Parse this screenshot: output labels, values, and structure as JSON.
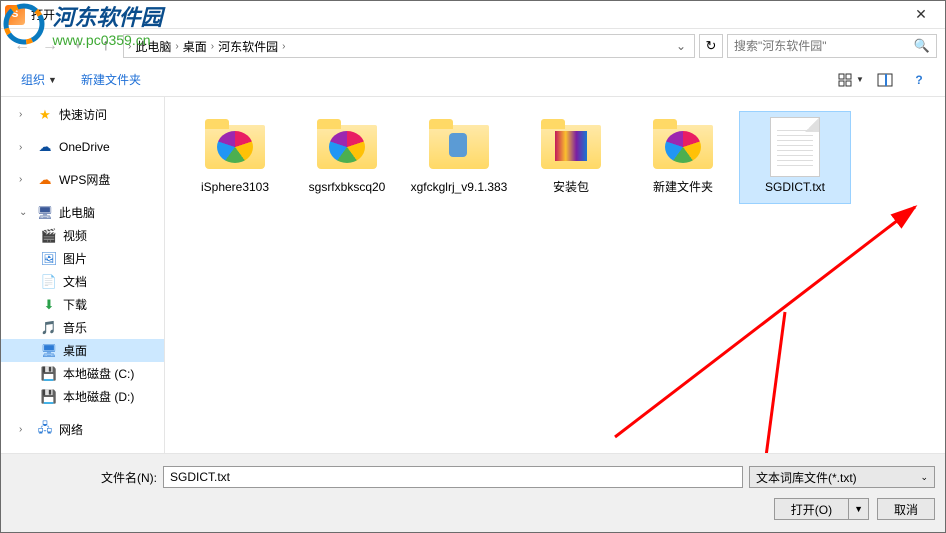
{
  "window": {
    "title": "打开",
    "icon_text": "S"
  },
  "watermark": {
    "title": "河东软件园",
    "url": "www.pc0359.cn"
  },
  "breadcrumb": {
    "items": [
      "此电脑",
      "桌面",
      "河东软件园"
    ]
  },
  "search": {
    "placeholder": "搜索\"河东软件园\""
  },
  "toolbar": {
    "organize": "组织",
    "new_folder": "新建文件夹"
  },
  "sidebar": {
    "quick_access": "快速访问",
    "onedrive": "OneDrive",
    "wps": "WPS网盘",
    "this_pc": "此电脑",
    "videos": "视频",
    "pictures": "图片",
    "documents": "文档",
    "downloads": "下载",
    "music": "音乐",
    "desktop": "桌面",
    "disk_c": "本地磁盘 (C:)",
    "disk_d": "本地磁盘 (D:)",
    "network": "网络"
  },
  "files": [
    {
      "name": "iSphere3103",
      "type": "folder",
      "inner": "pinwheel"
    },
    {
      "name": "sgsrfxbkscq20",
      "type": "folder",
      "inner": "pinwheel"
    },
    {
      "name": "xgfckglrj_v9.1.383",
      "type": "folder",
      "inner": "blue"
    },
    {
      "name": "安装包",
      "type": "folder",
      "inner": "mix"
    },
    {
      "name": "新建文件夹",
      "type": "folder",
      "inner": "pinwheel"
    },
    {
      "name": "SGDICT.txt",
      "type": "txt",
      "selected": true
    }
  ],
  "bottom": {
    "filename_label": "文件名(N):",
    "filename_value": "SGDICT.txt",
    "filetype": "文本词库文件(*.txt)",
    "open_button": "打开(O)",
    "cancel_button": "取消"
  }
}
